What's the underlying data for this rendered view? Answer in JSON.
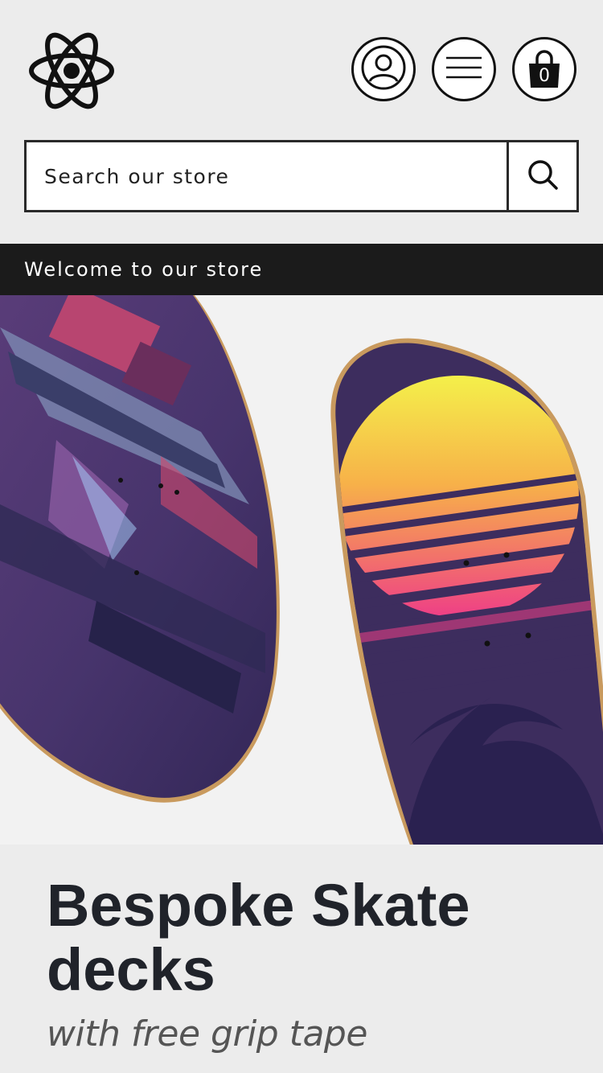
{
  "header": {
    "logo_icon": "atom-logo-icon",
    "account_icon": "user-account-icon",
    "menu_icon": "hamburger-menu-icon",
    "cart_icon": "shopping-bag-icon",
    "cart_count": "0"
  },
  "search": {
    "placeholder": "Search our store",
    "button_icon": "search-icon"
  },
  "announcement": {
    "text": "Welcome to our store"
  },
  "hero": {
    "image": "two-skateboard-decks-image",
    "headline": "Bespoke Skate decks",
    "subline": "with free grip tape"
  },
  "colors": {
    "background": "#ececec",
    "announcement_bar": "#1b1b1b",
    "headline": "#20232a",
    "subline": "#555555"
  }
}
